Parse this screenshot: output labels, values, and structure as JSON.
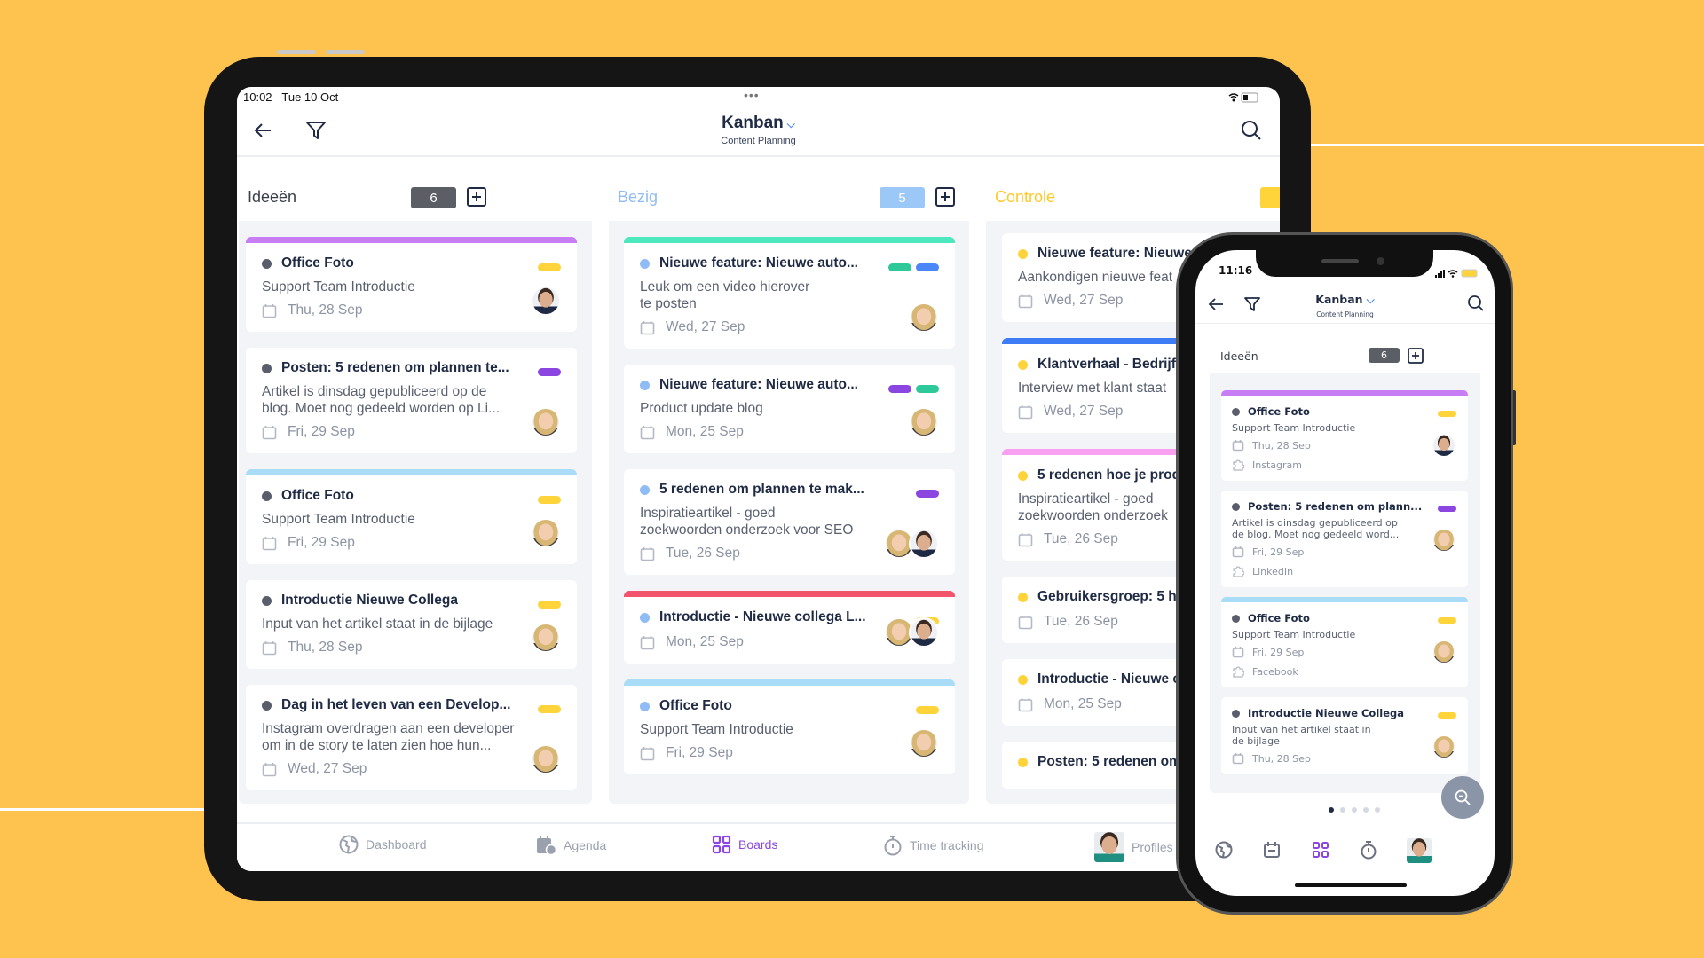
{
  "colors": {
    "background": "#FEC24F",
    "accent": "#8B45E0",
    "yellow": "#FFD43B",
    "purple": "#8B45E0",
    "green": "#2EC99A",
    "blue": "#4A86F7"
  },
  "tablet": {
    "status": {
      "time": "10:02",
      "date": "Tue 10 Oct"
    },
    "header": {
      "title": "Kanban",
      "subtitle": "Content Planning",
      "icons": [
        "back-arrow-icon",
        "filter-icon",
        "search-icon",
        "chevron-down-icon"
      ]
    },
    "columns": [
      {
        "name": "Ideeën",
        "count": "6",
        "badge_color": "#5C5E66",
        "name_color": "#3B3F4A",
        "dot": "#5A5D6B",
        "cards": [
          {
            "title": "Office Foto",
            "desc": [
              "Support Team Introductie"
            ],
            "date": "Thu, 28 Sep",
            "stripe": "#C77DF3",
            "tags": [
              "#FFD43B"
            ],
            "avatars": [
              "m"
            ]
          },
          {
            "title": "Posten: 5 redenen om plannen te...",
            "desc": [
              "Artikel is dinsdag gepubliceerd op de",
              "blog. Moet nog gedeeld worden op Li..."
            ],
            "date": "Fri, 29 Sep",
            "stripe": "",
            "tags": [
              "#8B45E0"
            ],
            "avatars": [
              "f"
            ]
          },
          {
            "title": "Office Foto",
            "desc": [
              "Support Team Introductie"
            ],
            "date": "Fri, 29 Sep",
            "stripe": "#A8DCF7",
            "tags": [
              "#FFD43B"
            ],
            "avatars": [
              "f"
            ]
          },
          {
            "title": "Introductie Nieuwe Collega",
            "desc": [
              "Input van het artikel staat in de bijlage"
            ],
            "date": "Thu, 28 Sep",
            "stripe": "",
            "tags": [
              "#FFD43B"
            ],
            "avatars": [
              "f"
            ]
          },
          {
            "title": "Dag in het leven van een Develop...",
            "desc": [
              "Instagram overdragen aan een developer",
              "om in de story te laten zien hoe hun..."
            ],
            "date": "Wed, 27 Sep",
            "stripe": "",
            "tags": [
              "#FFD43B"
            ],
            "avatars": [
              "f"
            ]
          }
        ]
      },
      {
        "name": "Bezig",
        "count": "5",
        "badge_color": "#9CC8F7",
        "name_color": "#8FBCF5",
        "dot": "#8FBCF5",
        "cards": [
          {
            "title": "Nieuwe feature: Nieuwe auto...",
            "desc": [
              "Leuk om een video hierover",
              "te posten"
            ],
            "date": "Wed, 27 Sep",
            "stripe": "#4DE8BE",
            "tags": [
              "#2EC99A",
              "#4A86F7"
            ],
            "avatars": [
              "f"
            ]
          },
          {
            "title": "Nieuwe feature: Nieuwe auto...",
            "desc": [
              "Product update blog"
            ],
            "date": "Mon, 25 Sep",
            "stripe": "",
            "tags": [
              "#8B45E0",
              "#2EC99A"
            ],
            "avatars": [
              "f"
            ]
          },
          {
            "title": "5 redenen om plannen te mak...",
            "desc": [
              "Inspiratieartikel - goed",
              "zoekwoorden onderzoek voor SEO"
            ],
            "date": "Tue, 26 Sep",
            "stripe": "",
            "tags": [
              "#8B45E0"
            ],
            "avatars": [
              "f",
              "m"
            ]
          },
          {
            "title": "Introductie - Nieuwe collega L...",
            "desc": [],
            "date": "Mon, 25 Sep",
            "stripe": "#F2556B",
            "tags": [
              "#FFD43B"
            ],
            "avatars": [
              "f",
              "m"
            ]
          },
          {
            "title": "Office Foto",
            "desc": [
              "Support Team Introductie"
            ],
            "date": "Fri, 29 Sep",
            "stripe": "#A8DCF7",
            "tags": [
              "#FFD43B"
            ],
            "avatars": [
              "f"
            ]
          }
        ]
      },
      {
        "name": "Controle",
        "count": "",
        "badge_color": "#FFD43B",
        "name_color": "#FFC928",
        "dot": "#FFD43B",
        "cards": [
          {
            "title": "Nieuwe feature: Nieuwe",
            "desc": [
              "Aankondigen nieuwe feat"
            ],
            "date": "Wed, 27 Sep",
            "stripe": "",
            "tags": [],
            "avatars": []
          },
          {
            "title": "Klantverhaal - Bedrijf",
            "desc": [
              "Interview met klant staat"
            ],
            "date": "Wed, 27 Sep",
            "stripe": "#3D7CF5",
            "tags": [],
            "avatars": []
          },
          {
            "title": "5 redenen hoe je prod",
            "desc": [
              "Inspiratieartikel - goed",
              "zoekwoorden onderzoek"
            ],
            "date": "Tue, 26 Sep",
            "stripe": "#F9A0F0",
            "tags": [],
            "avatars": []
          },
          {
            "title": "Gebruikersgroep: 5 ha",
            "desc": [],
            "date": "Tue, 26 Sep",
            "stripe": "",
            "tags": [],
            "avatars": []
          },
          {
            "title": "Introductie - Nieuwe c",
            "desc": [],
            "date": "Mon, 25 Sep",
            "stripe": "",
            "tags": [],
            "avatars": []
          },
          {
            "title": "Posten: 5 redenen om",
            "desc": [],
            "date": "",
            "stripe": "",
            "tags": [],
            "avatars": []
          }
        ]
      }
    ],
    "nav": [
      {
        "label": "Dashboard",
        "icon": "globe-icon"
      },
      {
        "label": "Agenda",
        "icon": "calendar-clock-icon"
      },
      {
        "label": "Boards",
        "icon": "boards-grid-icon",
        "active": true
      },
      {
        "label": "Time tracking",
        "icon": "stopwatch-icon"
      },
      {
        "label": "Profiles",
        "icon": "profile-avatar"
      }
    ]
  },
  "phone": {
    "status": {
      "time": "11:16"
    },
    "header": {
      "title": "Kanban",
      "subtitle": "Content Planning"
    },
    "column": {
      "name": "Ideeën",
      "count": "6",
      "cards": [
        {
          "title": "Office Foto",
          "desc": [
            "Support Team Introductie"
          ],
          "date": "Thu, 28 Sep",
          "platform": "Instagram",
          "stripe": "#C77DF3",
          "tags": [
            "#FFD43B"
          ],
          "avatars": [
            "m"
          ]
        },
        {
          "title": "Posten: 5 redenen om plann...",
          "desc": [
            "Artikel is dinsdag gepubliceerd op",
            "de blog. Moet nog gedeeld word..."
          ],
          "date": "Fri, 29 Sep",
          "platform": "LinkedIn",
          "stripe": "",
          "tags": [
            "#8B45E0"
          ],
          "avatars": [
            "f"
          ]
        },
        {
          "title": "Office Foto",
          "desc": [
            "Support Team Introductie"
          ],
          "date": "Fri, 29 Sep",
          "platform": "Facebook",
          "stripe": "#A8DCF7",
          "tags": [
            "#FFD43B"
          ],
          "avatars": [
            "f"
          ]
        },
        {
          "title": "Introductie Nieuwe Collega",
          "desc": [
            "Input van het artikel staat in",
            "de bijlage"
          ],
          "date": "Thu, 28 Sep",
          "platform": "",
          "stripe": "",
          "tags": [
            "#FFD43B"
          ],
          "avatars": [
            "f"
          ]
        }
      ]
    },
    "pager": {
      "pages": 5,
      "current": 1
    },
    "nav": [
      "globe-icon",
      "calendar-icon",
      "boards-grid-icon",
      "stopwatch-icon",
      "profile-avatar"
    ]
  }
}
